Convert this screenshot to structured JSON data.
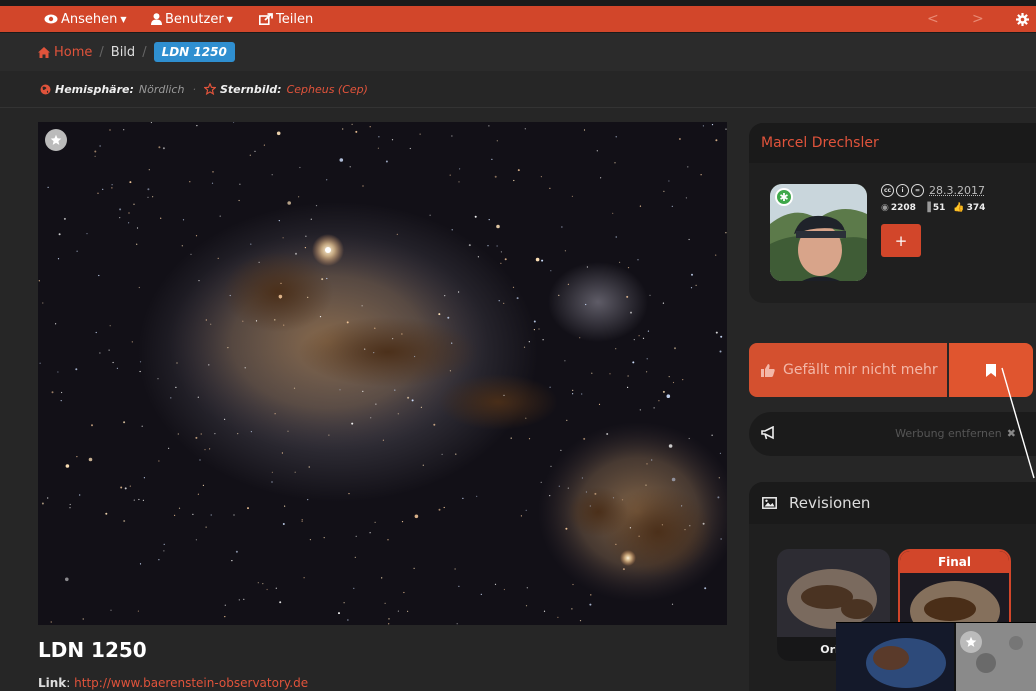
{
  "nav": {
    "view_label": "Ansehen",
    "users_label": "Benutzer",
    "share_label": "Teilen",
    "prev_glyph": "<",
    "next_glyph": ">"
  },
  "breadcrumb": {
    "home": "Home",
    "section": "Bild",
    "current": "LDN 1250",
    "separator": "/"
  },
  "meta": {
    "hemisphere_label": "Hemisphäre:",
    "hemisphere_value": "Nördlich",
    "constellation_label": "Sternbild:",
    "constellation_value": "Cepheus (Cep)",
    "separator": "·"
  },
  "image": {
    "title": "LDN 1250",
    "link_label": "Link",
    "link_url": "http://www.baerenstein-observatory.de"
  },
  "author": {
    "name": "Marcel Drechsler",
    "date": "28.3.2017",
    "views": "2208",
    "bookmarks": "51",
    "likes": "374",
    "follow_label": "+",
    "badge_glyph": "✱"
  },
  "actions": {
    "unlike_label": "Gefällt mir nicht mehr"
  },
  "ads": {
    "remove_label": "Werbung entfernen",
    "close_glyph": "✖"
  },
  "revisions": {
    "title": "Revisionen",
    "items": [
      {
        "label": "Orig"
      },
      {
        "label": "Final"
      }
    ]
  },
  "colors": {
    "accent": "#d2462a",
    "breadcrumb_active": "#2f8fd0",
    "link": "#e0533b"
  }
}
